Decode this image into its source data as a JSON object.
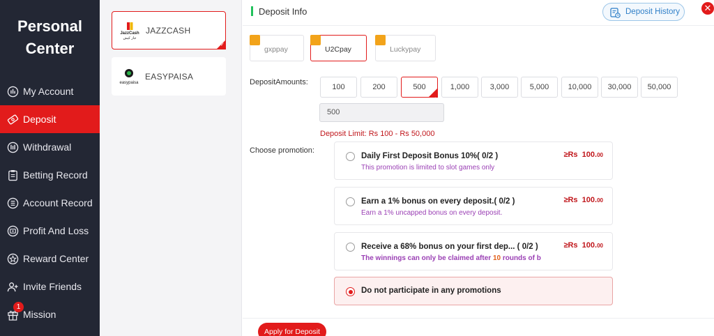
{
  "sidebar": {
    "title_line1": "Personal",
    "title_line2": "Center",
    "items": [
      {
        "label": "My Account"
      },
      {
        "label": "Deposit"
      },
      {
        "label": "Withdrawal"
      },
      {
        "label": "Betting Record"
      },
      {
        "label": "Account Record"
      },
      {
        "label": "Profit And Loss"
      },
      {
        "label": "Reward Center"
      },
      {
        "label": "Invite Friends"
      },
      {
        "label": "Mission",
        "badge": "1"
      }
    ]
  },
  "payment_methods": [
    {
      "name": "JAZZCASH",
      "logo_text": "JazzCash",
      "logo_subtext": "جاز کیش",
      "selected": true
    },
    {
      "name": "EASYPAISA",
      "logo_text": "easypaisa",
      "selected": false
    }
  ],
  "header": {
    "title": "Deposit Info",
    "history_label": "Deposit History"
  },
  "channels": [
    {
      "label": "gxppay",
      "selected": false
    },
    {
      "label": "U2Cpay",
      "selected": true
    },
    {
      "label": "Luckypay",
      "selected": false
    }
  ],
  "deposit": {
    "amounts_label": "DepositAmounts:",
    "amounts": [
      "100",
      "200",
      "500",
      "1,000",
      "3,000",
      "5,000",
      "10,000",
      "30,000",
      "50,000"
    ],
    "selected_amount": "500",
    "input_value": "500",
    "limit_text": "Deposit Limit:  Rs  100  -  Rs  50,000"
  },
  "promotion": {
    "label": "Choose promotion:",
    "options": [
      {
        "title": "Daily First Deposit Bonus 10%( 0/2 )",
        "desc": "This promotion is limited to slot games only",
        "amount_prefix": "≥Rs",
        "amount": "100.",
        "amount_cents": "00"
      },
      {
        "title": "Earn a 1% bonus on every deposit.( 0/2 )",
        "desc": "Earn a 1% uncapped bonus on every deposit.",
        "amount_prefix": "≥Rs",
        "amount": "100.",
        "amount_cents": "00"
      },
      {
        "title": "Receive a 68% bonus on your first dep...  ( 0/2 )",
        "desc_pre": "The winnings can only be claimed after ",
        "desc_num": "10",
        "desc_post": " rounds of b",
        "amount_prefix": "≥Rs",
        "amount": "100.",
        "amount_cents": "00"
      }
    ],
    "none_label": "Do not participate in any promotions"
  },
  "footer": {
    "apply_label": "Apply for Deposit"
  },
  "colors": {
    "accent": "#e21b1b",
    "sidebar_bg": "#232734",
    "header_bar": "#21c15c",
    "promo_desc": "#9a3fb4"
  }
}
